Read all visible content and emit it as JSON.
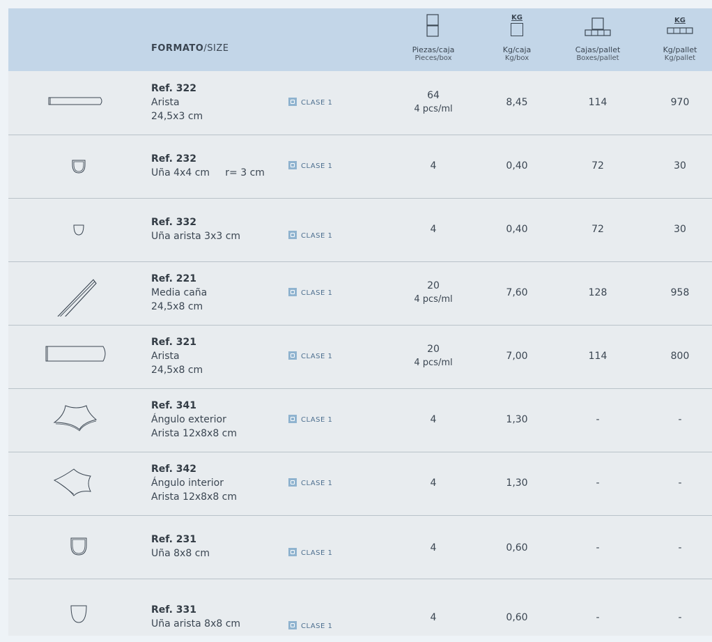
{
  "header": {
    "size_bold": "FORMATO",
    "size_rest": "/SIZE",
    "col_pieces_es": "Piezas/caja",
    "col_pieces_en": "Pieces/box",
    "col_kgbox_es": "Kg/caja",
    "col_kgbox_en": "Kg/box",
    "col_boxes_es": "Cajas/pallet",
    "col_boxes_en": "Boxes/pallet",
    "col_kgpallet_es": "Kg/pallet",
    "col_kgpallet_en": "Kg/pallet",
    "kg_icon_text": "KG"
  },
  "rows": [
    {
      "ref": "Ref. 322",
      "line1": "Arista",
      "line2": "24,5x3 cm",
      "clase": "CLASE 1",
      "pieces": "64",
      "pieces_sub": "4 pcs/ml",
      "kg_box": "8,45",
      "boxes_pallet": "114",
      "kg_pallet": "970",
      "icon": "arista-thin-icon"
    },
    {
      "ref": "Ref. 232",
      "line1": "Uña 4x4 cm     r= 3 cm",
      "line2": "",
      "clase": "CLASE 1",
      "pieces": "4",
      "pieces_sub": "",
      "kg_box": "0,40",
      "boxes_pallet": "72",
      "kg_pallet": "30",
      "icon": "una-icon"
    },
    {
      "ref": "Ref. 332",
      "line1": "Uña arista 3x3 cm",
      "line2": "",
      "clase": "CLASE 1",
      "pieces": "4",
      "pieces_sub": "",
      "kg_box": "0,40",
      "boxes_pallet": "72",
      "kg_pallet": "30",
      "icon": "una-arista-small-icon"
    },
    {
      "ref": "Ref. 221",
      "line1": "Media caña",
      "line2": "24,5x8 cm",
      "clase": "CLASE 1",
      "pieces": "20",
      "pieces_sub": "4 pcs/ml",
      "kg_box": "7,60",
      "boxes_pallet": "128",
      "kg_pallet": "958",
      "icon": "media-cana-icon"
    },
    {
      "ref": "Ref. 321",
      "line1": "Arista",
      "line2": "24,5x8 cm",
      "clase": "CLASE 1",
      "pieces": "20",
      "pieces_sub": "4 pcs/ml",
      "kg_box": "7,00",
      "boxes_pallet": "114",
      "kg_pallet": "800",
      "icon": "arista-wide-icon"
    },
    {
      "ref": "Ref. 341",
      "line1": "Ángulo exterior",
      "line2": "Arista 12x8x8 cm",
      "clase": "CLASE 1",
      "pieces": "4",
      "pieces_sub": "",
      "kg_box": "1,30",
      "boxes_pallet": "-",
      "kg_pallet": "-",
      "icon": "angulo-exterior-icon"
    },
    {
      "ref": "Ref. 342",
      "line1": "Ángulo interior",
      "line2": "Arista 12x8x8 cm",
      "clase": "CLASE 1",
      "pieces": "4",
      "pieces_sub": "",
      "kg_box": "1,30",
      "boxes_pallet": "-",
      "kg_pallet": "-",
      "icon": "angulo-interior-icon"
    },
    {
      "ref": "Ref. 231",
      "line1": "Uña 8x8 cm",
      "line2": "",
      "clase": "CLASE 1",
      "pieces": "4",
      "pieces_sub": "",
      "kg_box": "0,60",
      "boxes_pallet": "-",
      "kg_pallet": "-",
      "icon": "una-large-icon"
    },
    {
      "ref": "Ref. 331",
      "line1": "Uña arista 8x8 cm",
      "line2": "",
      "clase": "CLASE 1",
      "pieces": "4",
      "pieces_sub": "",
      "kg_box": "0,60",
      "boxes_pallet": "-",
      "kg_pallet": "-",
      "icon": "una-arista-large-icon"
    }
  ]
}
